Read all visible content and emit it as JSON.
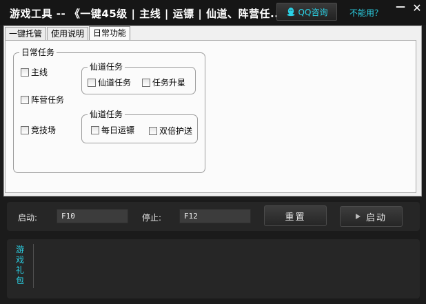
{
  "window": {
    "title": "游戏工具 -- 《一键45级 | 主线 | 运镖 | 仙道、阵营任...",
    "qq_button": "QQ咨询",
    "help_link": "不能用？",
    "minimize_glyph": "—",
    "close_glyph": "✕"
  },
  "tabs": [
    {
      "label": "一键托管"
    },
    {
      "label": "使用说明"
    },
    {
      "label": "日常功能",
      "active": true
    }
  ],
  "daily": {
    "group_title": "日常任务",
    "main_line": "主线",
    "faction_quest": "阵营任务",
    "arena": "竞技场",
    "xiandao1": {
      "title": "仙道任务",
      "quest": "仙道任务",
      "upgrade": "任务升星"
    },
    "xiandao2": {
      "title": "仙道任务",
      "daily_escort": "每日运镖",
      "double_escort": "双倍护送"
    }
  },
  "controls": {
    "start_label": "启动:",
    "start_key": "F10",
    "stop_label": "停止:",
    "stop_key": "F12",
    "reset_button": "重置",
    "start_button": "启动"
  },
  "bottom": {
    "gift_tab": "游戏礼包"
  },
  "colors": {
    "accent": "#2bd2e6",
    "dark_bg": "#1b1b1b"
  }
}
